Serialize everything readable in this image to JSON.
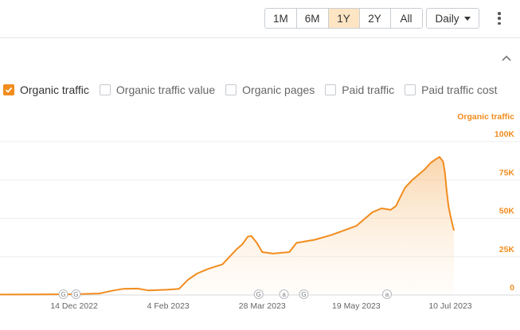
{
  "toolbar": {
    "ranges": [
      {
        "label": "1M",
        "active": false
      },
      {
        "label": "6M",
        "active": false
      },
      {
        "label": "1Y",
        "active": true
      },
      {
        "label": "2Y",
        "active": false
      },
      {
        "label": "All",
        "active": false
      }
    ],
    "interval_label": "Daily",
    "accent_color": "#f28c1e",
    "active_range_bg": "#fde5c4"
  },
  "metrics": [
    {
      "label": "Organic traffic",
      "checked": true
    },
    {
      "label": "Organic traffic value",
      "checked": false
    },
    {
      "label": "Organic pages",
      "checked": false
    },
    {
      "label": "Paid traffic",
      "checked": false
    },
    {
      "label": "Paid traffic cost",
      "checked": false
    }
  ],
  "chart_data": {
    "type": "area",
    "ylabel": "Organic traffic",
    "ylim": [
      0,
      100000
    ],
    "yticks": [
      {
        "value": 0,
        "label": "0"
      },
      {
        "value": 25000,
        "label": "25K"
      },
      {
        "value": 50000,
        "label": "50K"
      },
      {
        "value": 75000,
        "label": "75K"
      },
      {
        "value": 100000,
        "label": "100K"
      }
    ],
    "xlim": [
      "2022-11-03",
      "2023-07-23"
    ],
    "xticks": [
      {
        "date": "2022-12-14",
        "label": "14 Dec 2022"
      },
      {
        "date": "2023-02-04",
        "label": "4 Feb 2023"
      },
      {
        "date": "2023-03-28",
        "label": "28 Mar 2023"
      },
      {
        "date": "2023-05-19",
        "label": "19 May 2023"
      },
      {
        "date": "2023-07-10",
        "label": "10 Jul 2023"
      }
    ],
    "grid": true,
    "line_color": "#f28c1e",
    "markers": [
      {
        "date": "2022-12-08",
        "label": "G"
      },
      {
        "date": "2022-12-15",
        "label": "G"
      },
      {
        "date": "2023-03-26",
        "label": "G"
      },
      {
        "date": "2023-04-09",
        "label": "a"
      },
      {
        "date": "2023-04-20",
        "label": "G"
      },
      {
        "date": "2023-06-05",
        "label": "a"
      }
    ],
    "series": [
      {
        "points": [
          [
            "2022-11-03",
            300
          ],
          [
            "2022-11-25",
            400
          ],
          [
            "2022-12-14",
            500
          ],
          [
            "2022-12-28",
            1000
          ],
          [
            "2023-01-05",
            3000
          ],
          [
            "2023-01-10",
            4000
          ],
          [
            "2023-01-18",
            4200
          ],
          [
            "2023-01-24",
            3000
          ],
          [
            "2023-02-04",
            3500
          ],
          [
            "2023-02-10",
            4000
          ],
          [
            "2023-02-15",
            10000
          ],
          [
            "2023-02-20",
            14000
          ],
          [
            "2023-02-26",
            17000
          ],
          [
            "2023-03-06",
            20000
          ],
          [
            "2023-03-10",
            25000
          ],
          [
            "2023-03-14",
            30000
          ],
          [
            "2023-03-17",
            33000
          ],
          [
            "2023-03-20",
            38000
          ],
          [
            "2023-03-22",
            38500
          ],
          [
            "2023-03-25",
            34000
          ],
          [
            "2023-03-28",
            28000
          ],
          [
            "2023-04-03",
            27000
          ],
          [
            "2023-04-12",
            28000
          ],
          [
            "2023-04-16",
            34000
          ],
          [
            "2023-04-26",
            36000
          ],
          [
            "2023-05-05",
            39000
          ],
          [
            "2023-05-12",
            42000
          ],
          [
            "2023-05-19",
            45000
          ],
          [
            "2023-05-24",
            50000
          ],
          [
            "2023-05-28",
            54000
          ],
          [
            "2023-06-02",
            56500
          ],
          [
            "2023-06-07",
            55500
          ],
          [
            "2023-06-10",
            58000
          ],
          [
            "2023-06-12",
            63000
          ],
          [
            "2023-06-15",
            70000
          ],
          [
            "2023-06-19",
            75000
          ],
          [
            "2023-06-22",
            78000
          ],
          [
            "2023-06-26",
            82000
          ],
          [
            "2023-06-29",
            86000
          ],
          [
            "2023-07-02",
            88500
          ],
          [
            "2023-07-04",
            90000
          ],
          [
            "2023-07-06",
            87000
          ],
          [
            "2023-07-07",
            80000
          ],
          [
            "2023-07-08",
            68000
          ],
          [
            "2023-07-09",
            58000
          ],
          [
            "2023-07-10",
            52000
          ],
          [
            "2023-07-11",
            47000
          ],
          [
            "2023-07-12",
            42000
          ]
        ]
      }
    ]
  }
}
